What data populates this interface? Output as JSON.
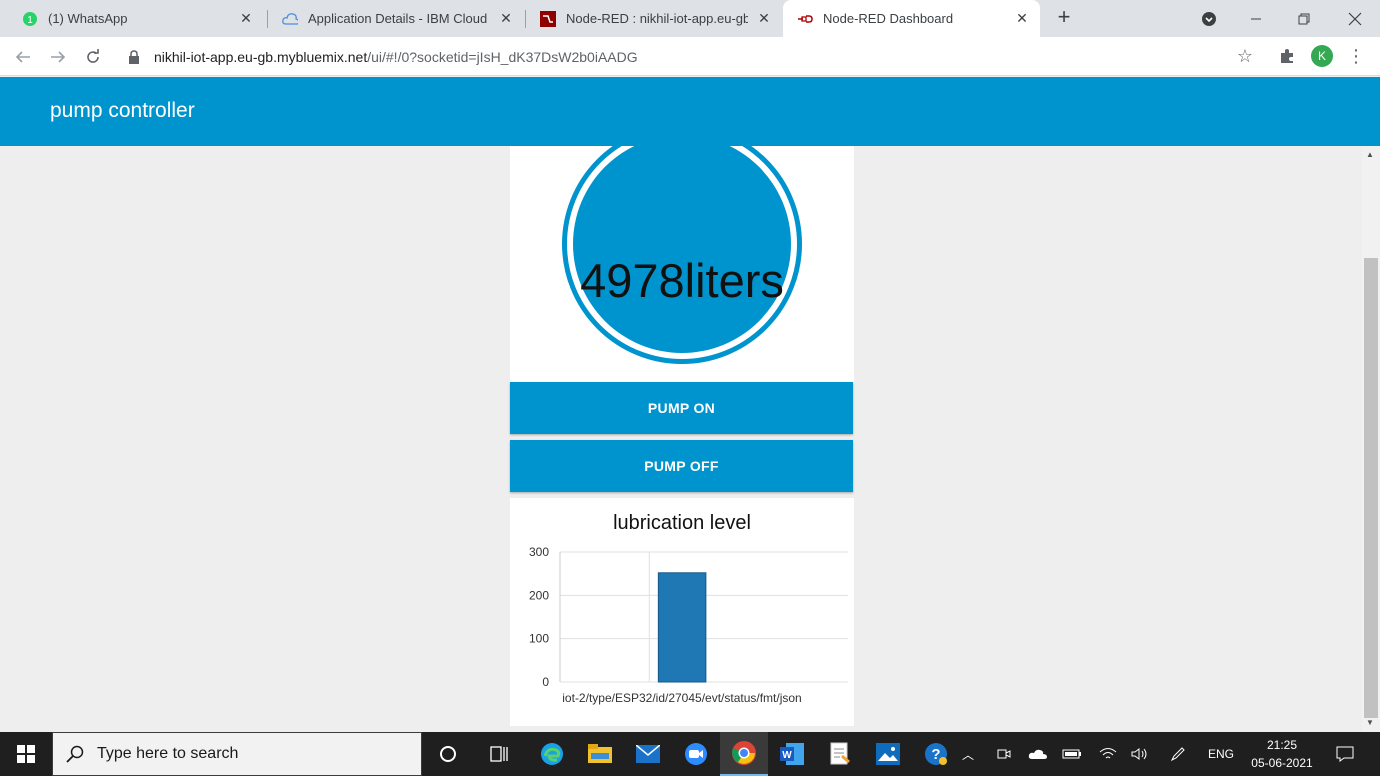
{
  "browser": {
    "tabs": [
      {
        "title": "(1) WhatsApp",
        "badge": "1"
      },
      {
        "title": "Application Details - IBM Cloud"
      },
      {
        "title": "Node-RED : nikhil-iot-app.eu-gb."
      },
      {
        "title": "Node-RED Dashboard"
      }
    ],
    "url_host": "nikhil-iot-app.eu-gb.mybluemix.net",
    "url_path": "/ui/#!/0?socketid=jIsH_dK37DsW2b0iAADG",
    "profile_initial": "K"
  },
  "dashboard": {
    "header_title": "pump controller",
    "gauge_text": "4978liters",
    "pump_on_label": "PUMP ON",
    "pump_off_label": "PUMP OFF"
  },
  "chart_data": {
    "type": "bar",
    "title": "lubrication level",
    "categories": [
      "iot-2/type/ESP32/id/27045/evt/status/fmt/json"
    ],
    "values": [
      252
    ],
    "ylim": [
      0,
      300
    ],
    "yticks": [
      0,
      100,
      200,
      300
    ],
    "grid": true,
    "bar_color": "#1f77b4"
  },
  "taskbar": {
    "search_placeholder": "Type here to search",
    "language": "ENG",
    "time": "21:25",
    "date": "05-06-2021"
  },
  "colors": {
    "accent": "#0094ce",
    "tab_strip": "#dee1e6"
  }
}
